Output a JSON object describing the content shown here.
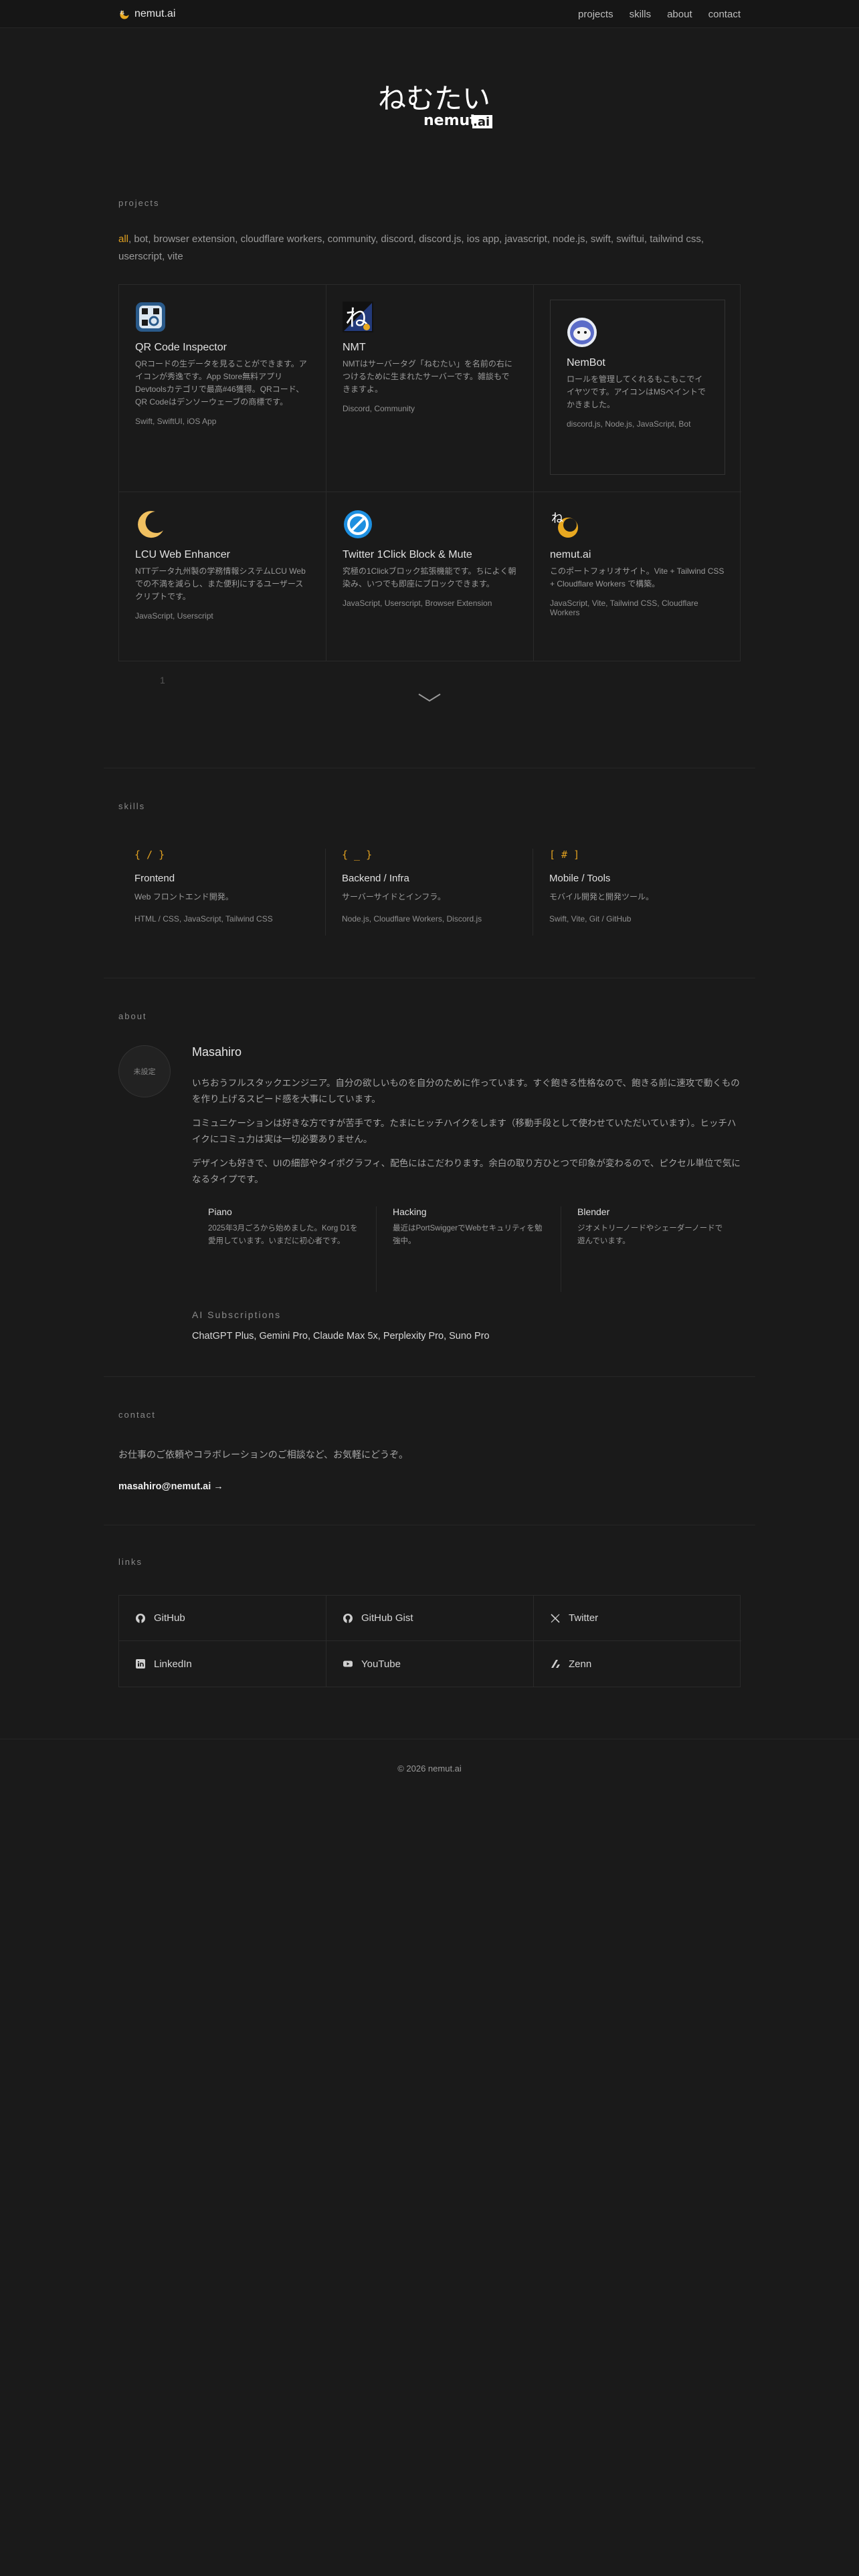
{
  "nav": {
    "brand": "nemut.ai",
    "links": [
      "projects",
      "skills",
      "about",
      "contact"
    ]
  },
  "hero": {
    "logo_text_jp": "ねむたい",
    "logo_text_en_a": "nemut",
    "logo_text_en_b": ".ai"
  },
  "projects": {
    "label": "projects",
    "active_tag": "all",
    "other_tags": ", bot, browser extension, cloudflare workers, community, discord, discord.js, ios app, javascript, node.js, swift, swiftui, tailwind css, userscript, vite",
    "cards": [
      {
        "title": "QR Code Inspector",
        "desc": "QRコードの生データを見ることができます。アイコンが秀逸です。App Store無料アプリ Devtoolsカテゴリで最高#46獲得。QRコード、QR Codeはデンソーウェーブの商標です。",
        "stack": "Swift, SwiftUI, iOS App",
        "icon": "qr-inspector-icon"
      },
      {
        "title": "NMT",
        "desc": "NMTはサーバータグ「ねむたい」を名前の右につけるために生まれたサーバーです。雑談もできますよ。",
        "stack": "Discord, Community",
        "icon": "nmt-icon"
      },
      {
        "title": "NemBot",
        "desc": "ロールを管理してくれるもこもこでイイヤツです。アイコンはMSペイントでかきました。",
        "stack": "discord.js, Node.js, JavaScript, Bot",
        "icon": "nembot-icon"
      },
      {
        "title": "LCU Web Enhancer",
        "desc": "NTTデータ九州製の学務情報システムLCU Webでの不満を減らし、また便利にするユーザースクリプトです。",
        "stack": "JavaScript, Userscript",
        "icon": "moon-icon"
      },
      {
        "title": "Twitter 1Click Block & Mute",
        "desc": "究極の1Clickブロック拡張機能です。ちによく朝染み、いつでも即座にブロックできます。",
        "stack": "JavaScript, Userscript, Browser Extension",
        "icon": "block-icon"
      },
      {
        "title": "nemut.ai",
        "desc": "このポートフォリオサイト。Vite + Tailwind CSS + Cloudflare Workers で構築。",
        "stack": "JavaScript, Vite, Tailwind CSS, Cloudflare Workers",
        "icon": "nemutai-icon"
      }
    ],
    "pagination": "1"
  },
  "skills": {
    "label": "skills",
    "items": [
      {
        "symbol": "{ / }",
        "title": "Frontend",
        "desc": "Web フロントエンド開発。",
        "tech": "HTML / CSS, JavaScript, Tailwind CSS"
      },
      {
        "symbol": "{ _ }",
        "title": "Backend / Infra",
        "desc": "サーバーサイドとインフラ。",
        "tech": "Node.js, Cloudflare Workers, Discord.js"
      },
      {
        "symbol": "[ # ]",
        "title": "Mobile / Tools",
        "desc": "モバイル開発と開発ツール。",
        "tech": "Swift, Vite, Git / GitHub"
      }
    ]
  },
  "about": {
    "label": "about",
    "avatar": "未設定",
    "name": "Masahiro",
    "paragraphs": [
      "いちおうフルスタックエンジニア。自分の欲しいものを自分のために作っています。すぐ飽きる性格なので、飽きる前に速攻で動くものを作り上げるスピード感を大事にしています。",
      "コミュニケーションは好きな方ですが苦手です。たまにヒッチハイクをします（移動手段として使わせていただいています）。ヒッチハイクにコミュ力は実は一切必要ありません。",
      "デザインも好きで、UIの細部やタイポグラフィ、配色にはこだわります。余白の取り方ひとつで印象が変わるので、ピクセル単位で気になるタイプです。"
    ],
    "hobbies": [
      {
        "title": "Piano",
        "desc": "2025年3月ごろから始めました。Korg D1を愛用しています。いまだに初心者です。"
      },
      {
        "title": "Hacking",
        "desc": "最近はPortSwiggerでWebセキュリティを勉強中。"
      },
      {
        "title": "Blender",
        "desc": "ジオメトリーノードやシェーダーノードで遊んでいます。"
      }
    ],
    "ai_title": "AI Subscriptions",
    "ai_list": "ChatGPT Plus,  Gemini Pro,  Claude Max 5x,  Perplexity Pro,  Suno Pro"
  },
  "contact": {
    "label": "contact",
    "message": "お仕事のご依頼やコラボレーションのご相談など、お気軽にどうぞ。",
    "email": "masahiro@nemut.ai →"
  },
  "links": {
    "label": "links",
    "items": [
      {
        "label": "GitHub",
        "icon": "github-icon"
      },
      {
        "label": "GitHub Gist",
        "icon": "github-gist-icon"
      },
      {
        "label": "Twitter",
        "icon": "x-twitter-icon"
      },
      {
        "label": "LinkedIn",
        "icon": "linkedin-icon"
      },
      {
        "label": "YouTube",
        "icon": "youtube-icon"
      },
      {
        "label": "Zenn",
        "icon": "zenn-icon"
      }
    ]
  },
  "footer": {
    "copyright": "© 2026 nemut.ai"
  },
  "colors": {
    "background": "#1a1a1a",
    "accent": "#e0a020",
    "moon": "#e8a820"
  }
}
